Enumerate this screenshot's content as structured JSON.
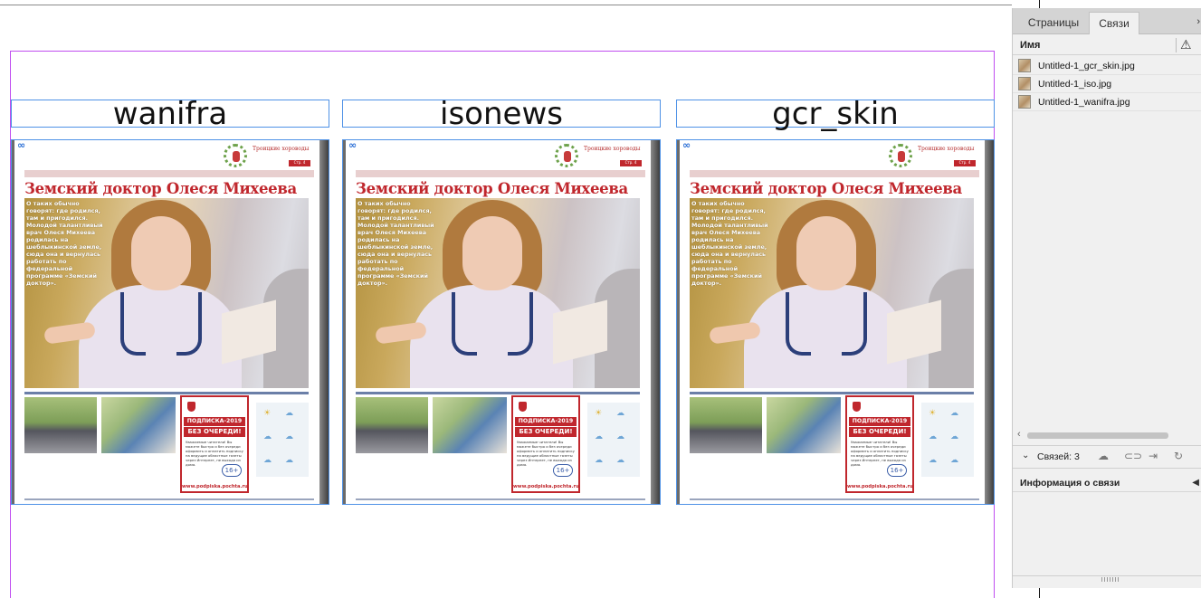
{
  "canvas": {
    "labels": [
      "wanifra",
      "isonews",
      "gcr_skin"
    ],
    "newspaper": {
      "masthead": "Троицкие хороводы",
      "page_tag": "Стр. 4",
      "headline": "Земский доктор Олеся Михеева",
      "lead": "О таких обычно говорят: где родился, там и пригодился. Молодой талантливый врач Олеся Михеева родилась на шеблыкинской земле, сюда она и вернулась работать по федеральной программе «Земский доктор».",
      "ad_title_1": "ПОДПИСКА-2019",
      "ad_title_2": "БЕЗ ОЧЕРЕДИ!",
      "ad_text": "Уважаемые читатели! Вы можете быстро и без очереди оформить и оплатить подписку на ведущие областные газеты через Интернет, не выходя из дома.",
      "ad_age": "16+",
      "ad_url": "www.podpiska.pochta.ru"
    }
  },
  "panel": {
    "tabs": [
      "Страницы",
      "Связи"
    ],
    "column_name": "Имя",
    "files": [
      "Untitled-1_gcr_skin.jpg",
      "Untitled-1_iso.jpg",
      "Untitled-1_wanifra.jpg"
    ],
    "links_count": "Связей: 3",
    "info_title": "Информация о связи"
  }
}
